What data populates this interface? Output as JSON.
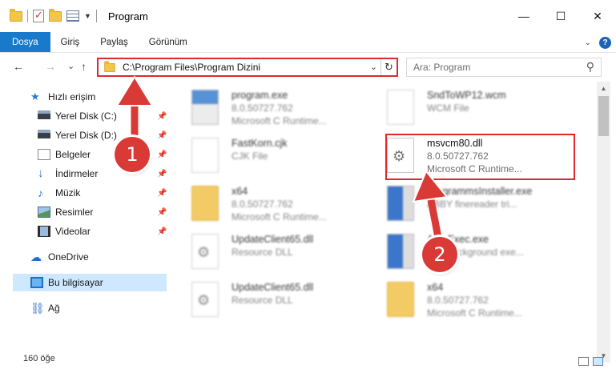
{
  "window": {
    "title": "Program",
    "minimize": "—",
    "maximize": "☐",
    "close": "✕"
  },
  "ribbon": {
    "tabs": [
      "Dosya",
      "Giriş",
      "Paylaş",
      "Görünüm"
    ],
    "help": "?"
  },
  "address": {
    "path": "C:\\Program Files\\Program Dizini",
    "dropdown": "⌄",
    "refresh": "↻"
  },
  "search": {
    "placeholder": "Ara: Program",
    "icon": "search-icon"
  },
  "nav": {
    "back": "←",
    "forward": "→",
    "recent": "⌄",
    "up": "↑"
  },
  "sidebar": {
    "items": [
      {
        "label": "Hızlı erişim",
        "icon": "star-icon"
      },
      {
        "label": "Yerel Disk (C:)",
        "icon": "disk-icon",
        "pinned": true
      },
      {
        "label": "Yerel Disk (D:)",
        "icon": "disk-icon",
        "pinned": true
      },
      {
        "label": "Belgeler",
        "icon": "documents-icon",
        "pinned": true
      },
      {
        "label": "İndirmeler",
        "icon": "download-icon",
        "pinned": true
      },
      {
        "label": "Müzik",
        "icon": "music-icon",
        "pinned": true
      },
      {
        "label": "Resimler",
        "icon": "pictures-icon",
        "pinned": true
      },
      {
        "label": "Videolar",
        "icon": "videos-icon",
        "pinned": true
      },
      {
        "label": "OneDrive",
        "icon": "cloud-icon"
      },
      {
        "label": "Bu bilgisayar",
        "icon": "computer-icon",
        "selected": true
      },
      {
        "label": "Ağ",
        "icon": "network-icon"
      }
    ],
    "pin_glyph": "📌"
  },
  "files": [
    {
      "name": "program.exe",
      "line1": "8.0.50727.762",
      "line2": "Microsoft C Runtime...",
      "icon": "exe-icon"
    },
    {
      "name": "SndToWP12.wcm",
      "line1": "WCM File",
      "line2": "",
      "icon": "document-icon"
    },
    {
      "name": "FastKorn.cjk",
      "line1": "CJK File",
      "line2": "",
      "icon": "document-icon"
    },
    {
      "name": "msvcm80.dll",
      "line1": "8.0.50727.762",
      "line2": "Microsoft C Runtime...",
      "icon": "dll-gear-icon"
    },
    {
      "name": "x64",
      "line1": "8.0.50727.762",
      "line2": "Microsoft C Runtime...",
      "icon": "folder-icon"
    },
    {
      "name": "ProgrammsInstaller.exe",
      "line1": "ABBY finereader tri...",
      "line2": "",
      "icon": "exe-icon"
    },
    {
      "name": "UpdateClient65.dll",
      "line1": "Resource DLL",
      "line2": "",
      "icon": "dll-gear-icon"
    },
    {
      "name": "AutoExec.exe",
      "line1": "Run background exe...",
      "line2": "",
      "icon": "exe-icon"
    },
    {
      "name": "UpdateClient65.dll",
      "line1": "Resource DLL",
      "line2": "",
      "icon": "dll-gear-icon"
    },
    {
      "name": "x64",
      "line1": "8.0.50727.762",
      "line2": "Microsoft C Runtime...",
      "icon": "folder-icon"
    }
  ],
  "status": {
    "count": "160 öğe"
  },
  "annotations": {
    "step1": "1",
    "step2": "2",
    "color": "#d93a36"
  }
}
